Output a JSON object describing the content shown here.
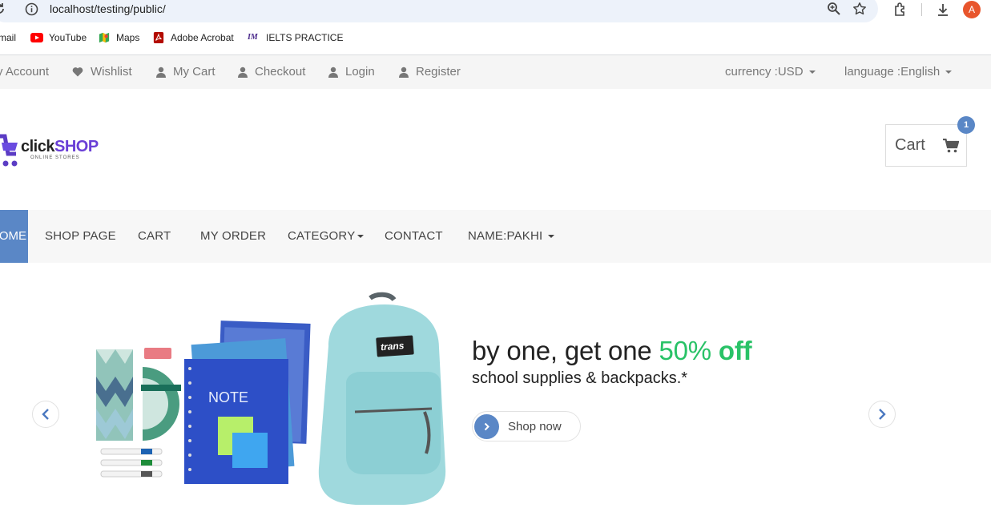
{
  "browser": {
    "url": "localhost/testing/public/",
    "avatar_letter": "A",
    "bookmarks": [
      {
        "label": "mail",
        "icon": "gmail-icon"
      },
      {
        "label": "YouTube",
        "icon": "youtube-icon"
      },
      {
        "label": "Maps",
        "icon": "maps-icon"
      },
      {
        "label": "Adobe Acrobat",
        "icon": "acrobat-icon"
      },
      {
        "label": "IELTS PRACTICE",
        "icon": "ielts-icon"
      }
    ]
  },
  "topbar": {
    "my_account": "y Account",
    "wishlist": "Wishlist",
    "my_cart": "My Cart",
    "checkout": "Checkout",
    "login": "Login",
    "register": "Register",
    "currency": "currency :USD",
    "language": "language :English"
  },
  "header": {
    "logo_text_click": "click",
    "logo_text_shop": "SHOP",
    "logo_tagline": "ONLINE STORES",
    "cart_label": "Cart",
    "cart_count": "1"
  },
  "nav": {
    "home": "HOME",
    "shop_page": "SHOP PAGE",
    "cart": "CART",
    "my_order": "MY ORDER",
    "category": "CATEGORY",
    "contact": "CONTACT",
    "name": "NAME:PAKHI"
  },
  "slider": {
    "headline_a": "by one, get one ",
    "headline_b": "50% ",
    "headline_c": "off",
    "subline": "school supplies & backpacks.*",
    "button": "Shop now",
    "product_brand": "trans",
    "notebook_label": "NOTE"
  },
  "colors": {
    "accent": "#5a87c6",
    "offer_green": "#29c267",
    "topbar_bg": "#f5f5f5",
    "nav_bg": "#f7f7f7"
  }
}
